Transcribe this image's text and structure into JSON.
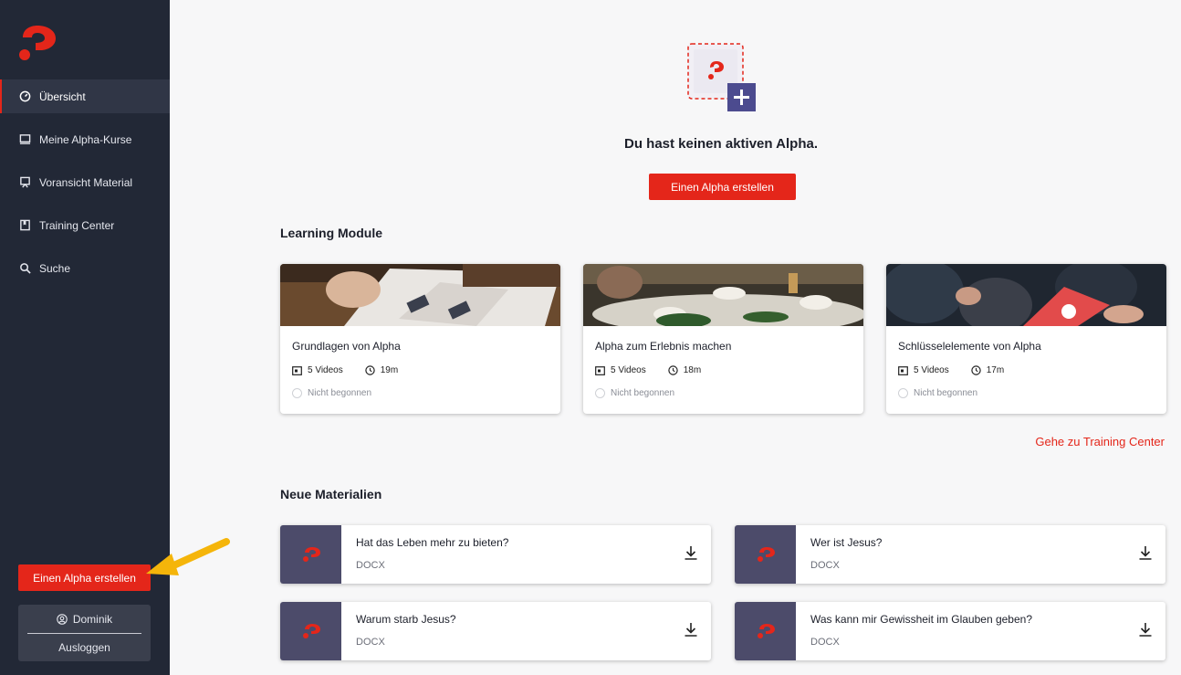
{
  "colors": {
    "sidebar": "#222836",
    "accent": "#e4261a",
    "material_thumb": "#4c4b6a"
  },
  "sidebar": {
    "logo": "alpha-logo-icon",
    "items": [
      {
        "label": "Übersicht",
        "icon": "dashboard-icon",
        "active": true
      },
      {
        "label": "Meine Alpha-Kurse",
        "icon": "screen-icon",
        "active": false
      },
      {
        "label": "Voransicht Material",
        "icon": "presentation-icon",
        "active": false
      },
      {
        "label": "Training Center",
        "icon": "book-icon",
        "active": false
      },
      {
        "label": "Suche",
        "icon": "search-icon",
        "active": false
      }
    ],
    "create_button": "Einen Alpha erstellen",
    "user_name": "Dominik",
    "logout": "Ausloggen"
  },
  "empty_state": {
    "title": "Du hast keinen aktiven Alpha.",
    "button": "Einen Alpha erstellen"
  },
  "learning": {
    "title": "Learning Module",
    "cards": [
      {
        "title": "Grundlagen von Alpha",
        "videos": "5 Videos",
        "duration": "19m",
        "status": "Nicht begonnen"
      },
      {
        "title": "Alpha zum Erlebnis machen",
        "videos": "5 Videos",
        "duration": "18m",
        "status": "Nicht begonnen"
      },
      {
        "title": "Schlüsselelemente von Alpha",
        "videos": "5 Videos",
        "duration": "17m",
        "status": "Nicht begonnen"
      }
    ],
    "link": "Gehe zu Training Center"
  },
  "materials": {
    "title": "Neue Materialien",
    "items": [
      {
        "title": "Hat das Leben mehr zu bieten?",
        "format": "DOCX"
      },
      {
        "title": "Wer ist Jesus?",
        "format": "DOCX"
      },
      {
        "title": "Warum starb Jesus?",
        "format": "DOCX"
      },
      {
        "title": "Was kann mir Gewissheit im Glauben geben?",
        "format": "DOCX"
      }
    ]
  }
}
